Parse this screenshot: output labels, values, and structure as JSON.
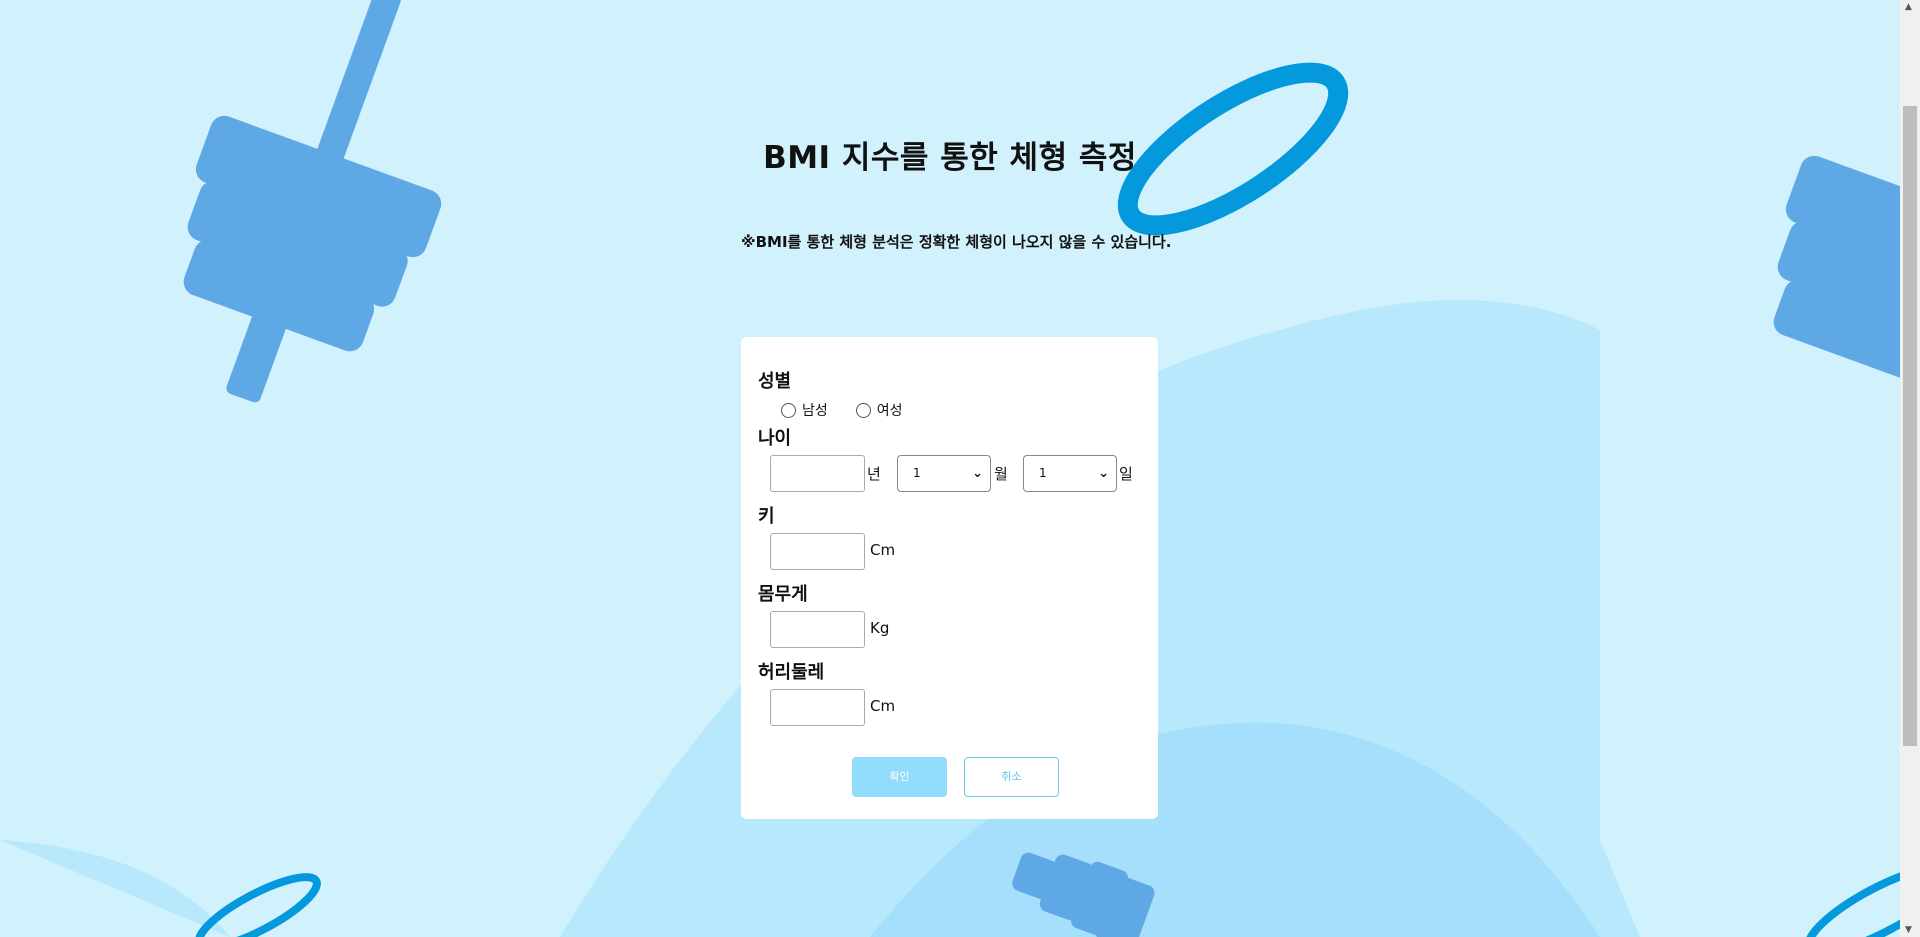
{
  "page": {
    "title": "BMI 지수를 통한 체형 측정",
    "notice": "※BMI를 통한 체형 분석은 정확한 체형이 나오지 않을 수 있습니다."
  },
  "form": {
    "gender": {
      "label": "성별",
      "options": [
        "남성",
        "여성"
      ]
    },
    "age": {
      "label": "나이",
      "year_unit": "년",
      "month_value": "1",
      "month_unit": "월",
      "day_value": "1",
      "day_unit": "일"
    },
    "height": {
      "label": "키",
      "unit": "Cm"
    },
    "weight": {
      "label": "몸무게",
      "unit": "Kg"
    },
    "waist": {
      "label": "허리둘레",
      "unit": "Cm"
    },
    "confirm_label": "확인",
    "cancel_label": "취소"
  },
  "colors": {
    "background": "#d1f2fc",
    "dumbbell": "#5fa8e6",
    "ring": "#0499dc",
    "blob": "#b3e6fb",
    "confirm": "#92dcfb"
  },
  "icons": {
    "select_arrow": "chevron-down-icon"
  }
}
